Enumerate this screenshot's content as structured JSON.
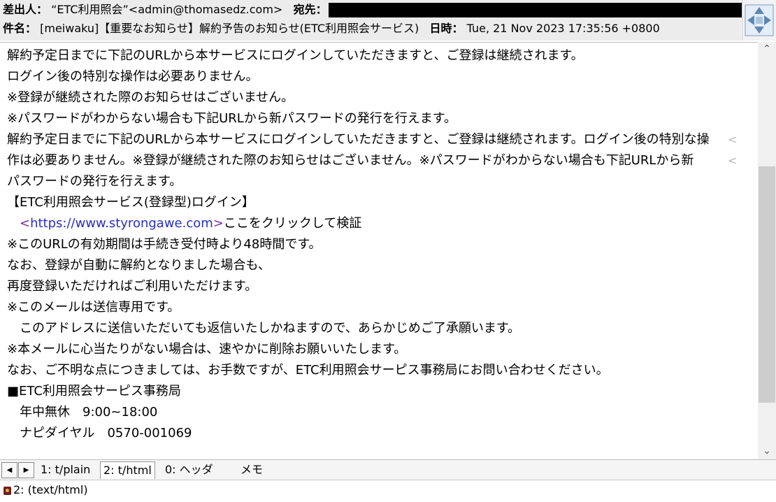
{
  "header": {
    "from_label": "差出人：",
    "from_value": "“ETC利用照会”<admin@thomasedz.com>",
    "to_label": "宛先：",
    "subject_label": "件名：",
    "subject_value": "[meiwaku]【重要なお知らせ】解約予告のお知らせ(ETC利用照会サービス)",
    "date_label": "日時：",
    "date_value": "Tue, 21 Nov 2023 17:35:56 +0800"
  },
  "body": {
    "lines": [
      "解約予定日までに下記のURLから本サービスにログインしていただきますと、ご登録は継続されます。",
      "ログイン後の特別な操作は必要ありません。",
      "※登録が継続された際のお知らせはございません。",
      "※パスワードがわからない場合も下記URLから新パスワードの発行を行えます。",
      "解約予定日までに下記のURLから本サービスにログインしていただきますと、ご登録は継続されます。ログイン後の特別な操",
      "作は必要ありません。※登録が継続された際のお知らせはございません。※パスワードがわからない場合も下記URLから新",
      "パスワードの発行を行えます。",
      "【ETC利用照会サービス(登録型)ログイン】",
      "",
      "※このURLの有効期間は手続き受付時より48時間です。",
      "なお、登録が自動に解約となりました場合も、",
      "再度登録いただければご利用いただけます。",
      "※このメールは送信専用です。",
      "　このアドレスに送信いただいても返信いたしかねますので、あらかじめご了承願います。",
      "※本メールに心当たりがない場合は、速やかに削除お願いいたします。",
      "なお、ご不明な点につきましては、お手数ですが、ETC利用照会サーピス事務局にお問い合わせください。",
      "■ETC利用照会サーピス事務局",
      "　年中無休　9:00~18:00",
      "　ナピダイヤル　0570-001069"
    ],
    "link_prefix": "　<",
    "link_url": "https://www.styrongawe.com",
    "link_suffix": ">",
    "link_after": "ここをクリックして検証",
    "wrap_mark": "<"
  },
  "tabs": {
    "prev_icon": "◀",
    "next_icon": "▶",
    "items": [
      "1: t/plain",
      "2: t/html",
      "0: ヘッダ",
      "メモ"
    ]
  },
  "status": {
    "text": "2: (text/html)"
  },
  "icons": {
    "nav": "four-way-arrow-icon",
    "scroll_up": "chevron-up-icon",
    "scroll_down": "chevron-down-icon",
    "attachment": "html-part-icon"
  }
}
